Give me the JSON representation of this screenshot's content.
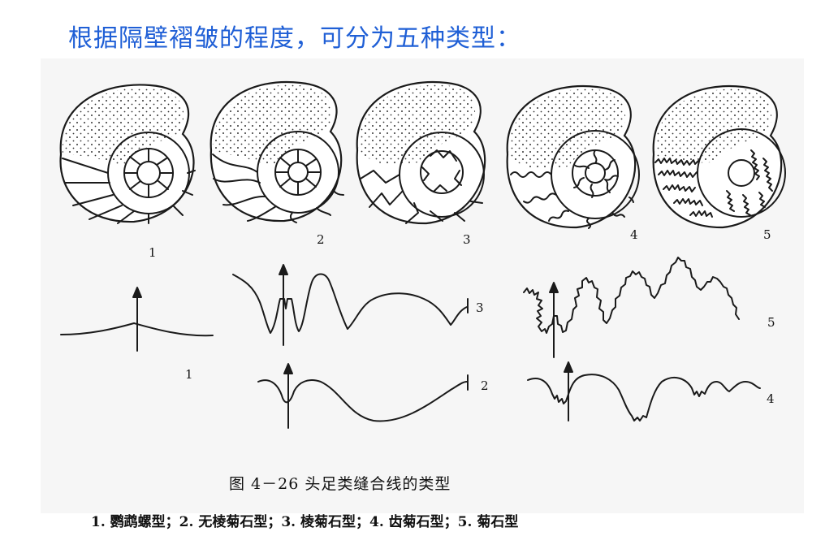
{
  "heading": "根据隔壁褶皱的程度，可分为五种类型：",
  "figure": {
    "caption": "图 4－26   头足类缝合线的类型",
    "legend": "1. 鹦鹉螺型；2. 无棱菊石型；3. 棱菊石型；4. 齿菊石型；5. 菊石型",
    "shell_labels": [
      "1",
      "2",
      "3",
      "4",
      "5"
    ],
    "suture_labels": [
      "1",
      "2",
      "3",
      "4",
      "5"
    ]
  }
}
